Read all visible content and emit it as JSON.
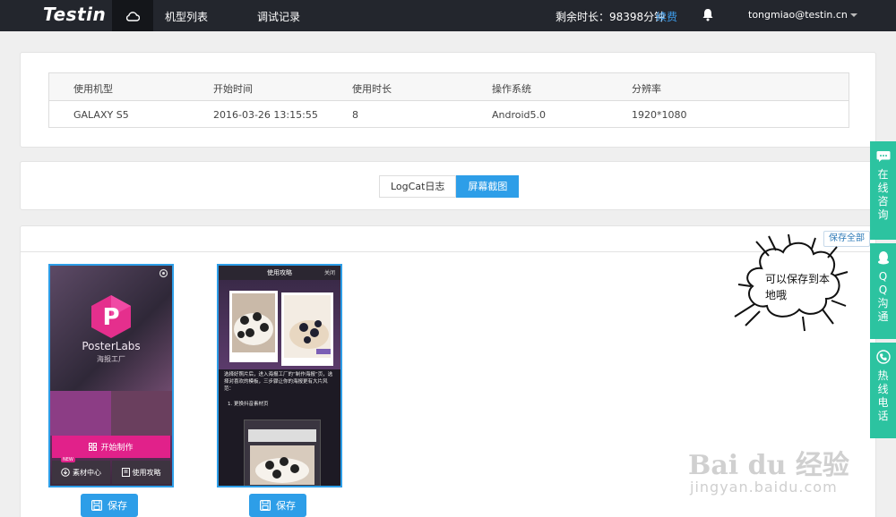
{
  "topbar": {
    "logo": "Testin",
    "nav": [
      "机型列表",
      "调试记录"
    ],
    "remaining": "剩余时长：98398分钟",
    "renew": "续费",
    "user": "tongmiao@testin.cn"
  },
  "info": {
    "headers": [
      "使用机型",
      "开始时间",
      "使用时长",
      "操作系统",
      "分辨率"
    ],
    "row": [
      "GALAXY S5",
      "2016-03-26 13:15:55",
      "8",
      "Android5.0",
      "1920*1080"
    ]
  },
  "tabs": [
    "LogCat日志",
    "屏幕截图"
  ],
  "save_all": "保存全部",
  "shot1": {
    "app_name": "PosterLabs",
    "app_sub": "海报工厂",
    "start_btn": "开始制作",
    "new_badge": "NEW",
    "materials": "素材中心",
    "guide": "使用攻略"
  },
  "shot2": {
    "title": "使用攻略",
    "close": "关闭",
    "desc": "选择好照片后，进入海报工厂的“制作海报”页，选择对喜欢的模板，三步骤让你的海报更有大片风范：",
    "step": "1. 更换抖音素材页"
  },
  "save_label": "保存",
  "float_bar": [
    "在线咨询",
    "QQ沟通",
    "热线电话"
  ],
  "callout": "可以保存到本地哦",
  "watermark": "Bai du 经验",
  "watermark_sub": "jingyan.baidu.com",
  "colors": {
    "accent": "#2d9ee8",
    "float": "#2cc3a0",
    "topbar": "#23262d"
  }
}
